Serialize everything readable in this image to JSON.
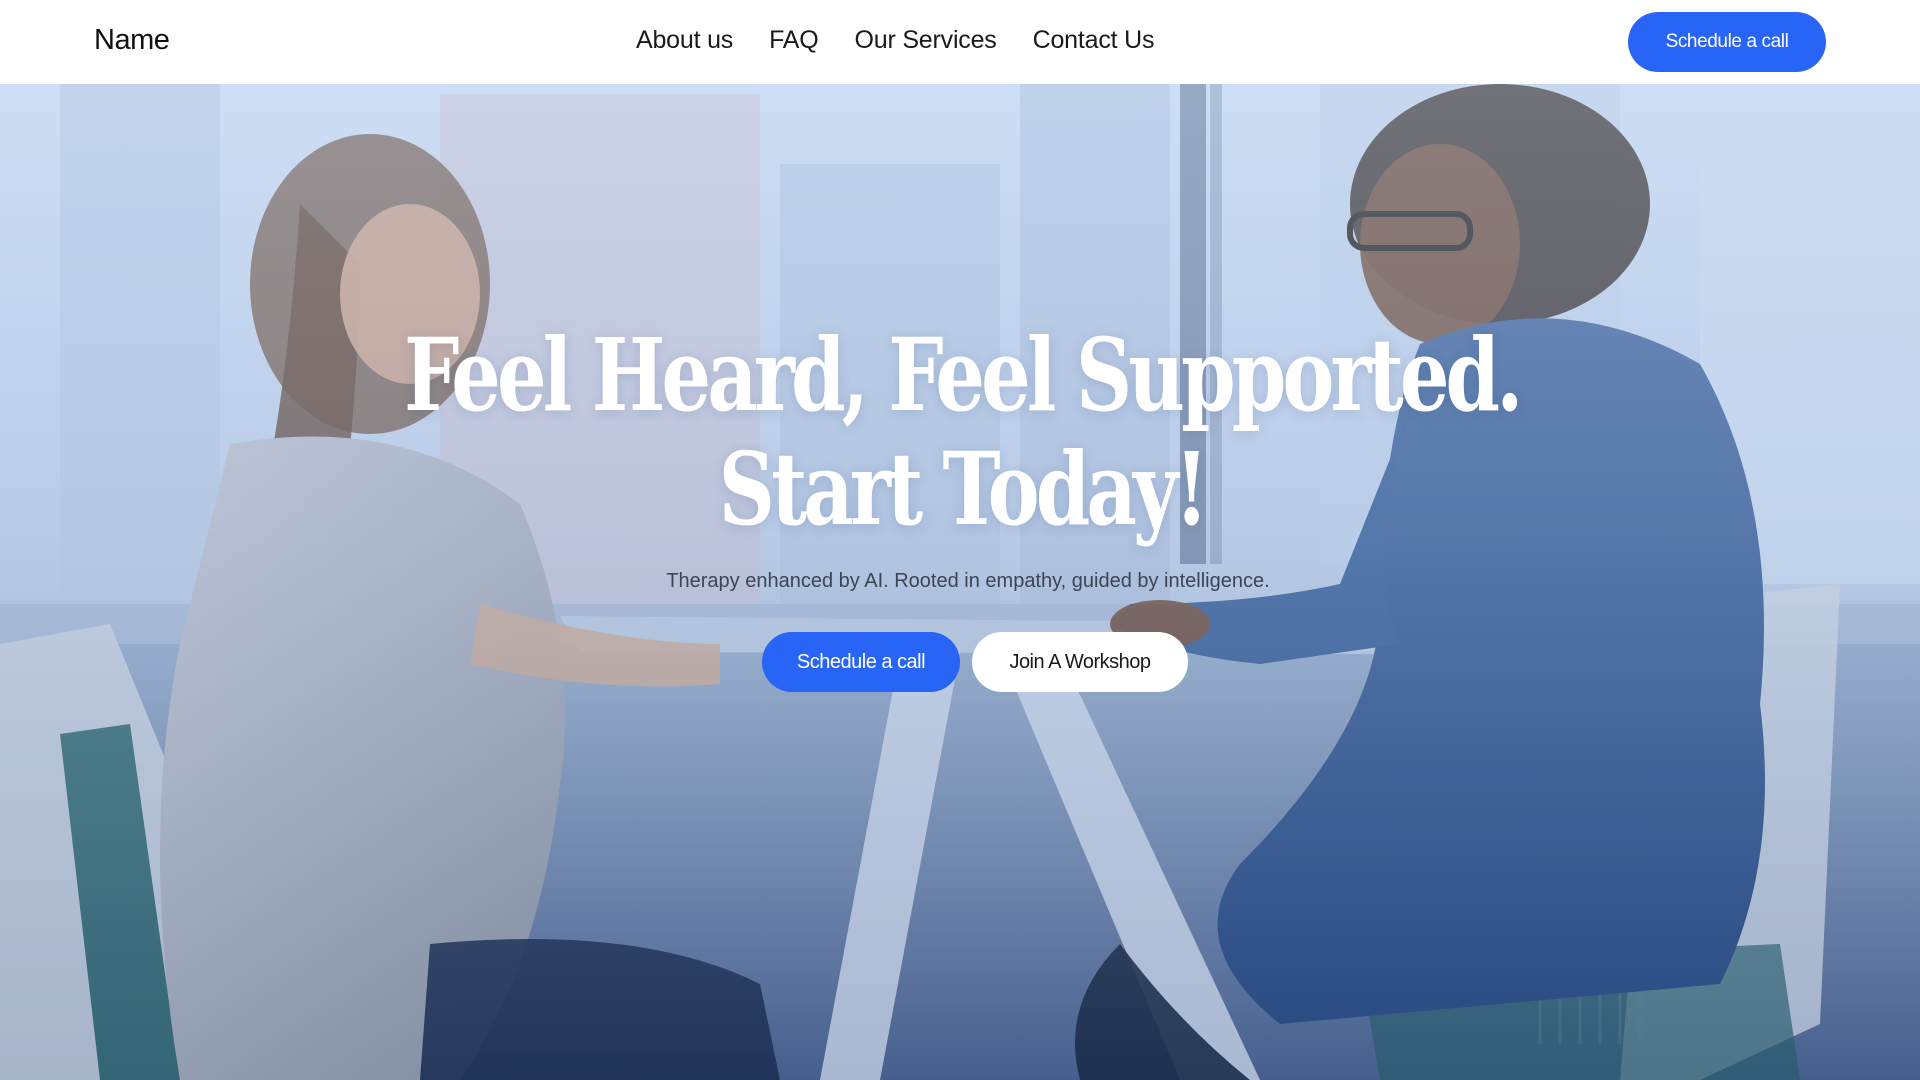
{
  "nav": {
    "brand": "Name",
    "links": [
      "About us",
      "FAQ",
      "Our Services",
      "Contact Us"
    ],
    "cta_label": "Schedule a call"
  },
  "hero": {
    "headline_line1": "Feel Heard, Feel Supported.",
    "headline_line2": "Start Today!",
    "subtitle": "Therapy enhanced by AI. Rooted in empathy, guided by intelligence.",
    "primary_button": "Schedule a call",
    "secondary_button": "Join A Workshop",
    "image_description_icon": "photo-background"
  },
  "colors": {
    "accent": "#2864f6",
    "nav_background": "#ffffff",
    "text_dark": "#1a1a1a",
    "headline": "#ffffff"
  }
}
